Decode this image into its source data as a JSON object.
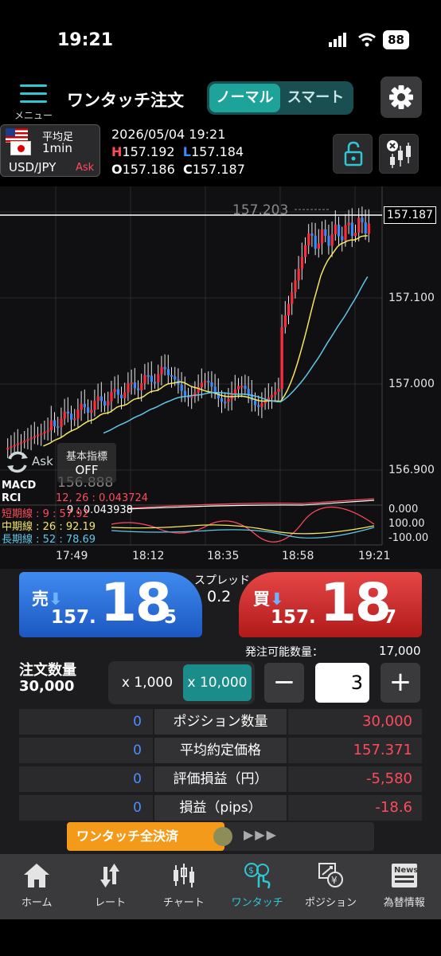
{
  "status": {
    "time": "19:21",
    "battery": "88"
  },
  "header": {
    "menu_label": "メニュー",
    "title": "ワンタッチ注文",
    "modes": [
      "ノーマル",
      "スマート"
    ],
    "active_mode": "ノーマル"
  },
  "info": {
    "bar_type": "平均足",
    "interval": "1min",
    "pair": "USD/JPY",
    "price_side": "Ask",
    "datetime": "2026/05/04 19:21",
    "high_key": "H",
    "high": "157.192",
    "low_key": "L",
    "low": "157.184",
    "open_key": "O",
    "open": "157.186",
    "close_key": "C",
    "close": "157.187"
  },
  "chart": {
    "current_price": "157.187",
    "y_labels": [
      "157.100",
      "157.000",
      "156.900"
    ],
    "x_labels": [
      "17:49",
      "18:12",
      "18:35",
      "18:58",
      "19:21"
    ],
    "high_marker": "157.203",
    "low_marker": "156.888",
    "ask_label": "Ask",
    "indicator_btn": {
      "line1": "基本指標",
      "line2": "OFF"
    },
    "macd": {
      "name": "MACD",
      "params": "12, 26 : 0.043724",
      "signal": "9 : 0.043938"
    },
    "rci": {
      "name": "RCI",
      "short": "短期線 : 9 : 57.92",
      "mid": "中期線 : 26 : 92.19",
      "long": "長期線 : 52 : 78.69"
    },
    "sub_y_labels": [
      "0.000",
      "100.00",
      "-100.00"
    ],
    "colors": {
      "up": "#ff2b3a",
      "down": "#3b8bff",
      "ma_short": "#f5e663",
      "ma_long": "#5fc7e8"
    }
  },
  "trade": {
    "sell_label": "売",
    "sell_prefix": "157.",
    "sell_big": "18",
    "sell_pip": "5",
    "buy_label": "買",
    "buy_prefix": "157.",
    "buy_big": "18",
    "buy_pip": "7",
    "spread_label": "スプレッド",
    "spread": "0.2",
    "avail_label": "発注可能数量：",
    "avail": "17,000",
    "qty_label": "注文数量",
    "qty_value": "30,000",
    "preset_1": "x 1,000",
    "preset_2": "x 10,000",
    "qty_input": "3"
  },
  "positions": [
    {
      "left": "0",
      "label": "ポジション数量",
      "right": "30,000"
    },
    {
      "left": "0",
      "label": "平均約定価格",
      "right": "157.371"
    },
    {
      "left": "0",
      "label": "評価損益（円）",
      "right": "-5,580"
    },
    {
      "left": "0",
      "label": "損益（pips）",
      "right": "-18.6"
    }
  ],
  "close_all": "ワンタッチ全決済",
  "tabs": [
    {
      "label": "ホーム",
      "icon": "home-icon"
    },
    {
      "label": "レート",
      "icon": "rate-arrows-icon"
    },
    {
      "label": "チャート",
      "icon": "candlestick-icon"
    },
    {
      "label": "ワンタッチ",
      "icon": "one-touch-icon"
    },
    {
      "label": "ポジション",
      "icon": "position-icon"
    },
    {
      "label": "為替情報",
      "icon": "news-icon"
    }
  ],
  "active_tab": "ワンタッチ"
}
